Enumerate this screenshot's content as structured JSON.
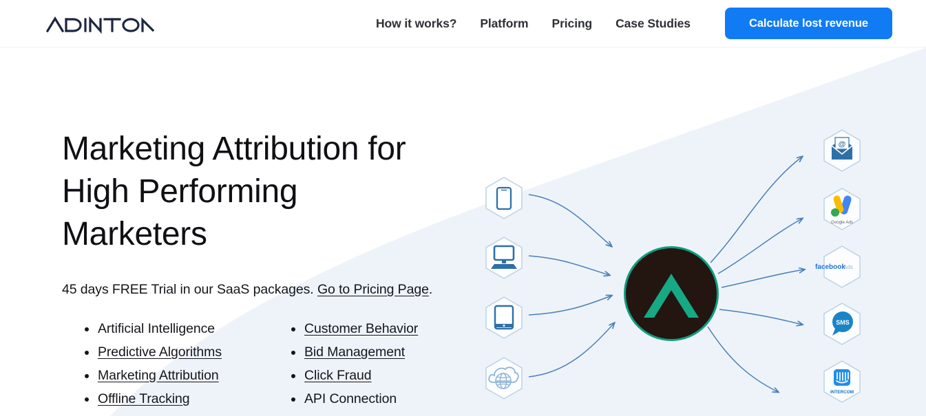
{
  "header": {
    "logo_text": "ADINTON",
    "nav": [
      {
        "label": "How it works?"
      },
      {
        "label": "Platform"
      },
      {
        "label": "Pricing"
      },
      {
        "label": "Case Studies"
      }
    ],
    "cta_label": "Calculate lost revenue",
    "cta_color": "#117bf3"
  },
  "hero": {
    "title_line1": "Marketing Attribution for",
    "title_line2": "High Performing",
    "title_line3": "Marketers",
    "subtitle_text": "45 days FREE Trial in our SaaS packages. ",
    "subtitle_link": "Go to Pricing Page",
    "subtitle_suffix": ".",
    "features_left": [
      {
        "label": "Artificial Intelligence",
        "link": false
      },
      {
        "label": "Predictive Algorithms",
        "link": true
      },
      {
        "label": "Marketing Attribution",
        "link": true
      },
      {
        "label": "Offline Tracking",
        "link": true
      }
    ],
    "features_right": [
      {
        "label": "Customer Behavior",
        "link": true
      },
      {
        "label": "Bid Management",
        "link": true
      },
      {
        "label": "Click Fraud",
        "link": true
      },
      {
        "label": "API Connection",
        "link": false
      }
    ]
  },
  "diagram": {
    "sources": [
      {
        "name": "mobile-phone-icon"
      },
      {
        "name": "desktop-computer-icon"
      },
      {
        "name": "tablet-icon"
      },
      {
        "name": "cloud-globe-icon"
      }
    ],
    "hub": {
      "name": "adinton-logo-mark",
      "circle_color": "#231510",
      "mark_color": "#17a884"
    },
    "destinations": [
      {
        "name": "email-icon",
        "label": ""
      },
      {
        "name": "google-ads-icon",
        "label": "Google Ads"
      },
      {
        "name": "facebook-ads-icon",
        "label": "facebook Ads"
      },
      {
        "name": "sms-icon",
        "label": "SMS"
      },
      {
        "name": "intercom-icon",
        "label": "INTERCOM"
      }
    ],
    "arrow_color": "#4a7fb5"
  },
  "colors": {
    "background": "#ffffff",
    "wedge": "#eef3fa",
    "text": "#14161a",
    "nav_text": "#2e3035",
    "accent_blue": "#117bf3",
    "icon_blue": "#3f7cb8",
    "teal": "#17a884"
  }
}
